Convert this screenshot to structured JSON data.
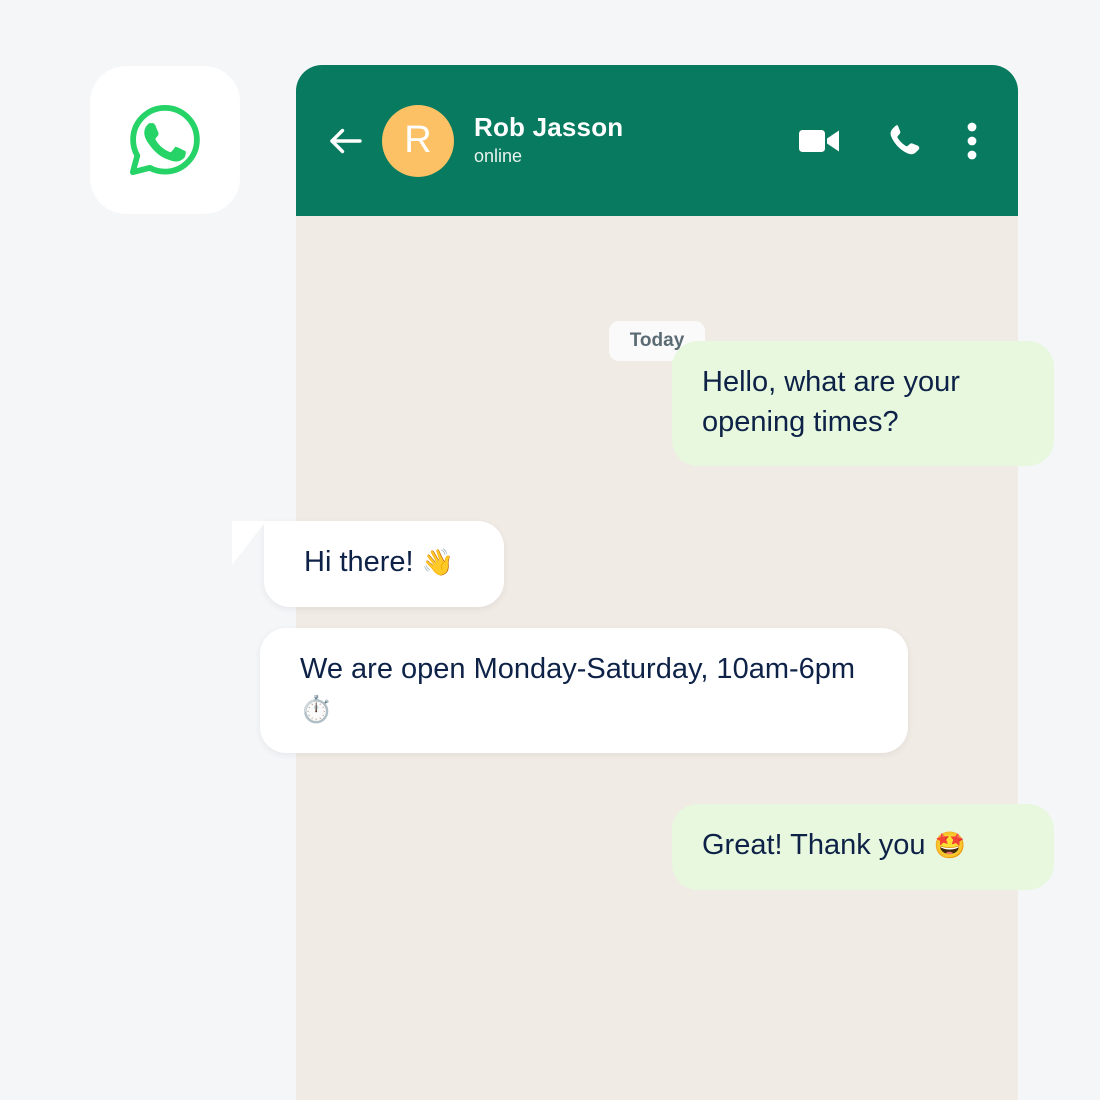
{
  "app": {
    "name": "WhatsApp",
    "logo_icon": "whatsapp-logo-icon",
    "brand_green": "#25d366",
    "header_green": "#087a5f",
    "chat_background": "#f1ebe5",
    "page_background": "#f4f6f8"
  },
  "header": {
    "back_icon": "back-arrow-icon",
    "avatar_initial": "R",
    "avatar_color": "#fbc164",
    "contact_name": "Rob Jasson",
    "status": "online",
    "actions": [
      {
        "icon": "video-call-icon",
        "label": "Video call"
      },
      {
        "icon": "voice-call-icon",
        "label": "Voice call"
      },
      {
        "icon": "overflow-menu-icon",
        "label": "More options"
      }
    ]
  },
  "conversation": {
    "day_divider": "Today",
    "messages": [
      {
        "id": "msg-out-1",
        "direction": "outgoing",
        "text": "Hello, what are your opening times?",
        "bubble_color": "#e7f8de"
      },
      {
        "id": "msg-in-1",
        "direction": "incoming",
        "text": "Hi there! ",
        "emoji": "👋",
        "bubble_color": "#ffffff",
        "has_tail": true
      },
      {
        "id": "msg-in-2",
        "direction": "incoming",
        "text": "We are open Monday-Saturday, 10am-6pm ",
        "emoji": "⏱️",
        "bubble_color": "#ffffff",
        "has_tail": false
      },
      {
        "id": "msg-out-2",
        "direction": "outgoing",
        "text": "Great! Thank you ",
        "emoji": "🤩",
        "bubble_color": "#e7f8de"
      }
    ]
  }
}
